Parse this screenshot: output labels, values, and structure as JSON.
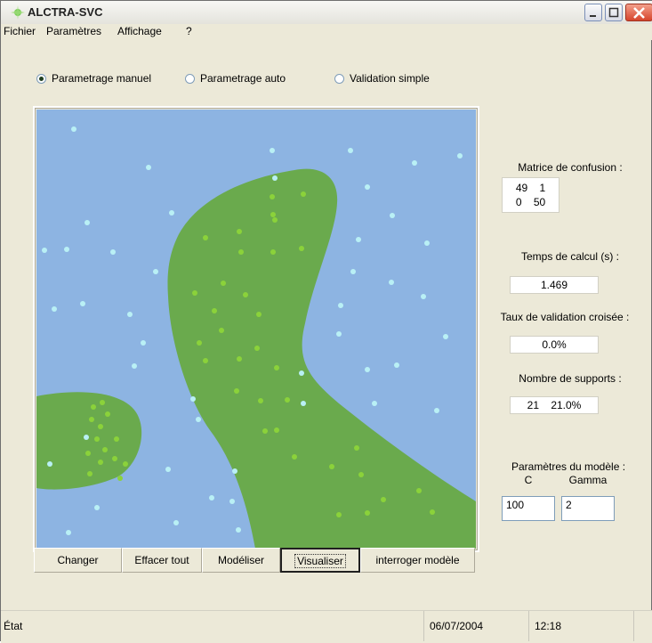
{
  "window": {
    "title": "ALCTRA-SVC"
  },
  "menu": {
    "items": [
      "Fichier",
      "Paramètres",
      "Affichage",
      "?"
    ]
  },
  "mode_options": [
    {
      "label": "Parametrage manuel",
      "selected": true
    },
    {
      "label": "Parametrage auto",
      "selected": false
    },
    {
      "label": "Validation simple",
      "selected": false
    }
  ],
  "buttons": {
    "changer": "Changer",
    "effacer": "Effacer tout",
    "modeliser": "Modéliser",
    "visualiser": "Visualiser",
    "interroger": "interroger modèle"
  },
  "results": {
    "confusion_label": "Matrice de confusion :",
    "confusion_row1": "49    1",
    "confusion_row2": "0    50",
    "time_label": "Temps de calcul (s) :",
    "time_value": "1.469",
    "cv_label": "Taux de validation croisée :",
    "cv_value": "0.0%",
    "supports_label": "Nombre de supports :",
    "supports_value": "21    21.0%",
    "params_label": "Paramètres du modèle :",
    "c_label": "C",
    "gamma_label": "Gamma",
    "c_value": "100",
    "gamma_value": "2"
  },
  "status": {
    "state": "État",
    "date": "06/07/2004",
    "time": "12:18"
  },
  "colors": {
    "background_region": "#8db4e2",
    "class_region": "#6aaa4d",
    "class_a_point": "#b9f0f5",
    "class_b_point": "#8bd23a"
  }
}
